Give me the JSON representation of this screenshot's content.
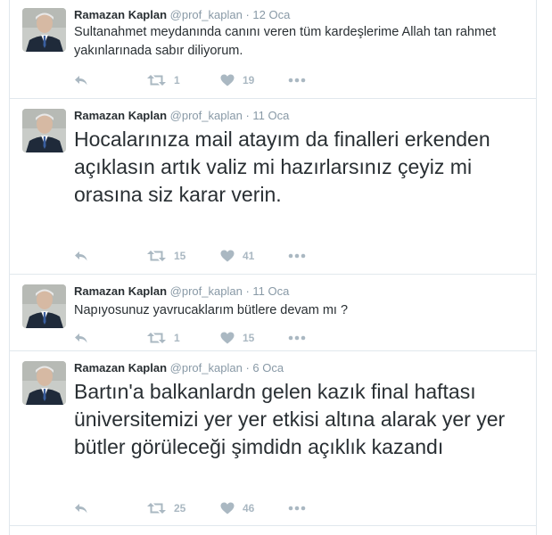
{
  "tweets": [
    {
      "fullname": "Ramazan Kaplan",
      "username": "@prof_kaplan",
      "separator": "·",
      "time": "12 Oca",
      "text": "Sultanahmet meydanında canını veren tüm kardeşlerime Allah tan rahmet yakınlarınada sabır diliyorum.",
      "retweets": "1",
      "likes": "19"
    },
    {
      "fullname": "Ramazan Kaplan",
      "username": "@prof_kaplan",
      "separator": "·",
      "time": "11 Oca",
      "text": "Hocalarınıza mail atayım da finalleri erkenden açıklasın artık valiz mi hazırlarsınız çeyiz mi orasına siz karar verin.",
      "retweets": "15",
      "likes": "41"
    },
    {
      "fullname": "Ramazan Kaplan",
      "username": "@prof_kaplan",
      "separator": "·",
      "time": "11 Oca",
      "text": "Napıyosunuz yavrucaklarım bütlere devam mı ?",
      "retweets": "1",
      "likes": "15"
    },
    {
      "fullname": "Ramazan Kaplan",
      "username": "@prof_kaplan",
      "separator": "·",
      "time": "6 Oca",
      "text": "Bartın'a balkanlardn gelen kazık final haftası üniversitemizi yer yer etkisi altına alarak yer yer bütler görüleceği şimdidn açıklık kazandı",
      "retweets": "25",
      "likes": "46"
    }
  ],
  "icons": {
    "reply": "reply-icon",
    "retweet": "retweet-icon",
    "like": "heart-icon",
    "more": "more-dots-icon"
  },
  "colors": {
    "text": "#292f33",
    "muted": "#8899a6",
    "action": "#aab8c2",
    "border": "#e1e8ed"
  }
}
